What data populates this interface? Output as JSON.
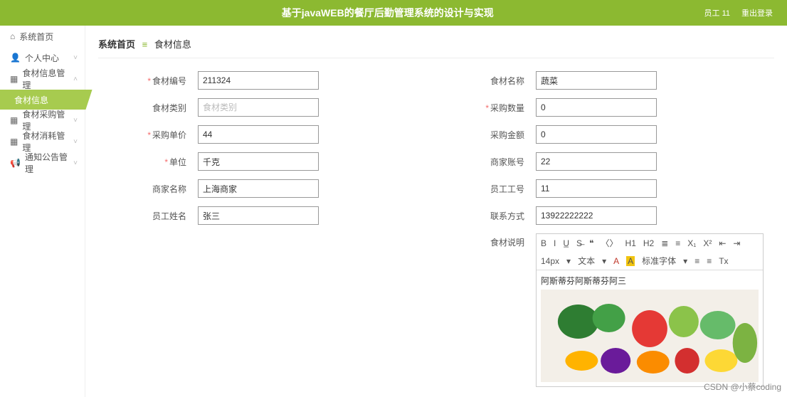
{
  "header": {
    "title": "基于javaWEB的餐厅后勤管理系统的设计与实现",
    "user": "员工 11",
    "logout": "重出登录"
  },
  "sidebar": {
    "items": [
      {
        "icon": "home",
        "label": "系统首页",
        "chev": ""
      },
      {
        "icon": "user",
        "label": "个人中心",
        "chev": "˅"
      },
      {
        "icon": "grid",
        "label": "食材信息管理",
        "chev": "˄",
        "sub": [
          {
            "label": "食材信息",
            "active": true
          }
        ]
      },
      {
        "icon": "grid",
        "label": "食材采购管理",
        "chev": "˅"
      },
      {
        "icon": "grid",
        "label": "食材消耗管理",
        "chev": "˅"
      },
      {
        "icon": "horn",
        "label": "通知公告管理",
        "chev": "˅"
      }
    ]
  },
  "breadcrumb": {
    "root": "系统首页",
    "sep": "≡",
    "current": "食材信息"
  },
  "form": {
    "left": [
      {
        "label": "食材编号",
        "required": true,
        "value": "211324",
        "placeholder": ""
      },
      {
        "label": "食材类别",
        "required": false,
        "value": "",
        "placeholder": "食材类别"
      },
      {
        "label": "采购单价",
        "required": true,
        "value": "44",
        "placeholder": ""
      },
      {
        "label": "单位",
        "required": true,
        "value": "千克",
        "placeholder": ""
      },
      {
        "label": "商家名称",
        "required": false,
        "value": "上海商家",
        "placeholder": ""
      },
      {
        "label": "员工姓名",
        "required": false,
        "value": "张三",
        "placeholder": ""
      }
    ],
    "right": [
      {
        "label": "食材名称",
        "required": false,
        "value": "蔬菜",
        "placeholder": ""
      },
      {
        "label": "采购数量",
        "required": true,
        "value": "0",
        "placeholder": ""
      },
      {
        "label": "采购金额",
        "required": false,
        "value": "0",
        "placeholder": ""
      },
      {
        "label": "商家账号",
        "required": false,
        "value": "22",
        "placeholder": ""
      },
      {
        "label": "员工工号",
        "required": false,
        "value": "11",
        "placeholder": ""
      },
      {
        "label": "联系方式",
        "required": false,
        "value": "13922222222",
        "placeholder": ""
      }
    ]
  },
  "editor": {
    "label": "食材说明",
    "toolbar_row1": [
      "B",
      "I",
      "U̲",
      "S̶",
      "❝",
      "〈〉",
      "H1",
      "H2",
      "≣",
      "≡",
      "X₁",
      "X²",
      "⇤",
      "⇥"
    ],
    "toolbar_row2": [
      "14px",
      "▾",
      "文本",
      "▾",
      "A",
      "A",
      "标准字体",
      "▾",
      "≡",
      "≡",
      "Tx"
    ],
    "content_text": "阿斯蒂芬阿斯蒂芬阿三"
  },
  "watermark": "CSDN @小蔡coding"
}
